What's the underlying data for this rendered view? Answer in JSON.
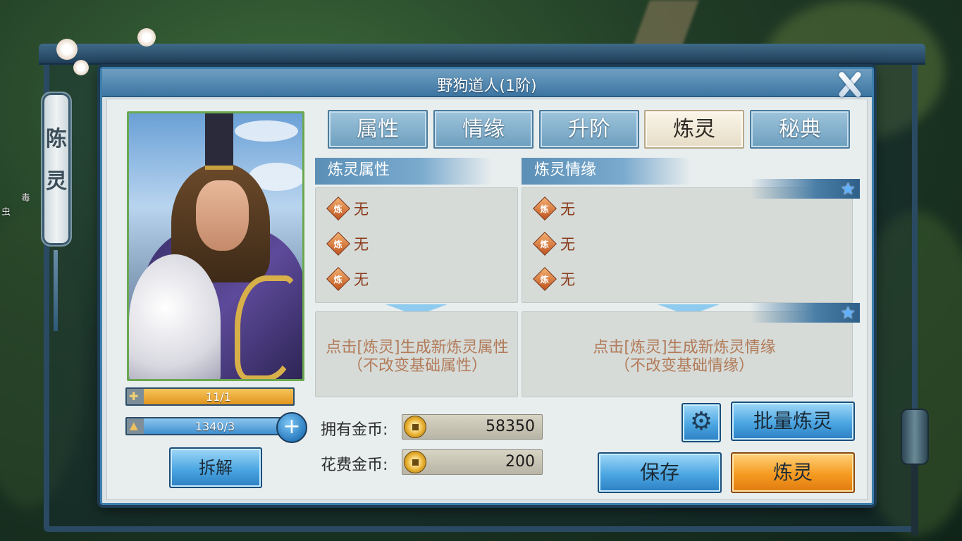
{
  "window": {
    "title": "野狗道人(1阶)",
    "side_label_chars": [
      "陈",
      "灵"
    ],
    "side_text_1": "毒",
    "side_text_2": "虫"
  },
  "tabs": [
    {
      "label": "属性",
      "active": false
    },
    {
      "label": "情缘",
      "active": false
    },
    {
      "label": "升阶",
      "active": false
    },
    {
      "label": "炼灵",
      "active": true
    },
    {
      "label": "秘典",
      "active": false
    }
  ],
  "portrait": {
    "shard_bar_text": "11/1",
    "exp_bar_text": "1340/3",
    "decompose_label": "拆解"
  },
  "refine_attr": {
    "header": "炼灵属性",
    "icon_char": "炼",
    "rows": [
      "无",
      "无",
      "无"
    ],
    "hint_line1": "点击[炼灵]生成新炼灵属性",
    "hint_line2": "（不改变基础属性）"
  },
  "refine_fate": {
    "header": "炼灵情缘",
    "icon_char": "炼",
    "rows": [
      "无",
      "无",
      "无"
    ],
    "hint_line1": "点击[炼灵]生成新炼灵情缘",
    "hint_line2": "（不改变基础情缘）"
  },
  "coins": {
    "owned_label": "拥有金币:",
    "owned_value": "58350",
    "cost_label": "花费金币:",
    "cost_value": "200"
  },
  "buttons": {
    "batch_label": "批量炼灵",
    "save_label": "保存",
    "refine_label": "炼灵"
  },
  "colors": {
    "tab_active": "#e6dcc6",
    "button_blue": "#4ba6e2",
    "button_orange": "#f59a20",
    "hint_text": "#b27a58"
  }
}
